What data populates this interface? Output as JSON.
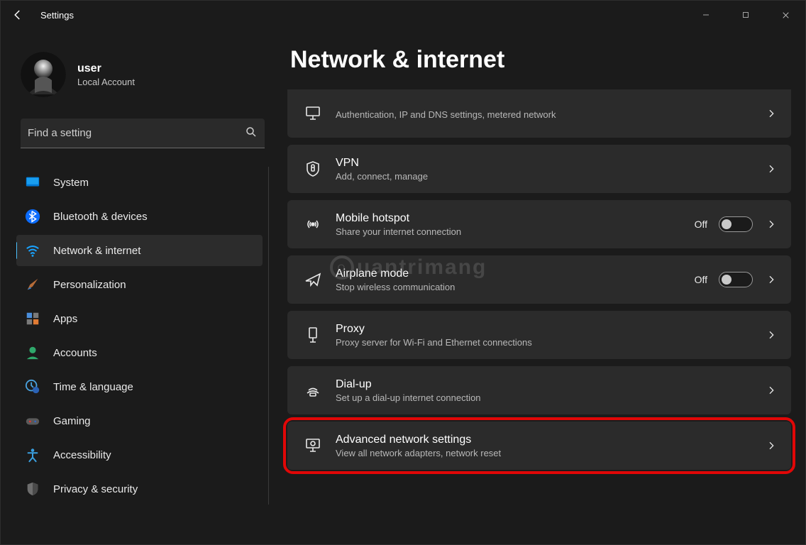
{
  "app_title": "Settings",
  "user": {
    "name": "user",
    "subtitle": "Local Account"
  },
  "search": {
    "placeholder": "Find a setting"
  },
  "sidebar": {
    "items": [
      {
        "id": "system",
        "label": "System"
      },
      {
        "id": "bluetooth",
        "label": "Bluetooth & devices"
      },
      {
        "id": "network",
        "label": "Network & internet"
      },
      {
        "id": "personalization",
        "label": "Personalization"
      },
      {
        "id": "apps",
        "label": "Apps"
      },
      {
        "id": "accounts",
        "label": "Accounts"
      },
      {
        "id": "time",
        "label": "Time & language"
      },
      {
        "id": "gaming",
        "label": "Gaming"
      },
      {
        "id": "accessibility",
        "label": "Accessibility"
      },
      {
        "id": "privacy",
        "label": "Privacy & security"
      }
    ],
    "active_id": "network"
  },
  "page": {
    "title": "Network & internet",
    "cards": [
      {
        "id": "ethernet",
        "title": "",
        "subtitle": "Authentication, IP and DNS settings, metered network"
      },
      {
        "id": "vpn",
        "title": "VPN",
        "subtitle": "Add, connect, manage"
      },
      {
        "id": "hotspot",
        "title": "Mobile hotspot",
        "subtitle": "Share your internet connection",
        "toggle_state": "Off"
      },
      {
        "id": "airplane",
        "title": "Airplane mode",
        "subtitle": "Stop wireless communication",
        "toggle_state": "Off"
      },
      {
        "id": "proxy",
        "title": "Proxy",
        "subtitle": "Proxy server for Wi-Fi and Ethernet connections"
      },
      {
        "id": "dialup",
        "title": "Dial-up",
        "subtitle": "Set up a dial-up internet connection"
      },
      {
        "id": "advanced",
        "title": "Advanced network settings",
        "subtitle": "View all network adapters, network reset"
      }
    ],
    "highlighted_card_id": "advanced"
  },
  "watermark": "uantrimang"
}
